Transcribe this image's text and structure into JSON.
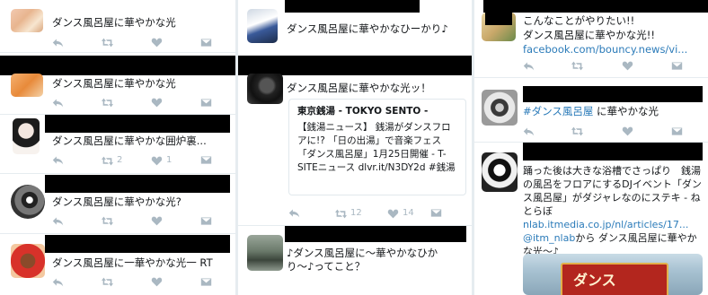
{
  "col1": {
    "tweets": [
      {
        "text": "ダンス風呂屋に華やかな光",
        "rt_count": "",
        "like_count": ""
      },
      {
        "text": "ダンス風呂屋に華やかな光",
        "rt_count": "",
        "like_count": ""
      },
      {
        "text": "ダンス風呂屋に華やかな囲炉裏...",
        "rt_count": "2",
        "like_count": "1"
      },
      {
        "text": "ダンス風呂屋に華やかな光?",
        "rt_count": "",
        "like_count": ""
      },
      {
        "text": "ダンス風呂屋に一華やかな光一 RT",
        "rt_count": "",
        "like_count": ""
      }
    ]
  },
  "col2": {
    "t1": {
      "text": "ダンス風呂屋に華やかなひーかり♪"
    },
    "t2": {
      "text": "ダンス風呂屋に華やかな光ッ！",
      "rt_count": "12",
      "like_count": "14"
    },
    "card": {
      "title": "東京銭湯 - TOKYO SENTO -",
      "body": "【銭湯ニュース】 銭湯がダンスフロアに!? 「日の出湯」で音楽フェス「ダンス風呂屋」1月25日開催 - T-SITEニュース dlvr.it/N3DY2d #銭湯"
    },
    "t3": {
      "text": "♪ダンス風呂屋に〜華やかなひかり〜♪ってこと？"
    }
  },
  "col3": {
    "t1": {
      "line1": "こんなことがやりたい!!",
      "line2": "ダンス風呂屋に華やかな光!!",
      "link": "facebook.com/bouncy.news/vi...",
      "rt_count": "",
      "like_count": ""
    },
    "t2": {
      "hashtag": "#ダンス風呂屋",
      "rest": " に華やかな光",
      "rt_count": "",
      "like_count": ""
    },
    "t3": {
      "body": "踊った後は大きな浴槽でさっぱり　銭湯の風呂をフロアにするDJイベント「ダンス風呂屋」がダジャレなのにステキ - ねとらぼ",
      "link1": "nlab.itmedia.co.jp/nl/articles/17...",
      "mention": "@itm_nlab",
      "mention_suffix": "から",
      "last": "ダンス風呂屋に華やかな光〜♪"
    },
    "image_caption": "ダンス"
  }
}
